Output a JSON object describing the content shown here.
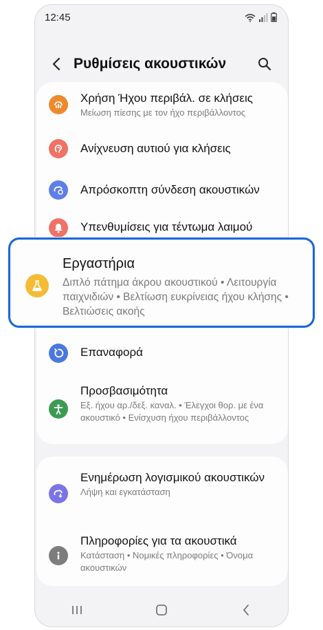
{
  "status_bar": {
    "time": "12:45"
  },
  "header": {
    "title": "Ρυθμίσεις ακουστικών"
  },
  "settings_group_1": [
    {
      "title": "Χρήση Ήχου περιβάλ. σε κλήσεις",
      "subtitle": "Μείωση πίεσης με τον ήχο περιβάλλοντος",
      "icon": "ambient-sound-icon",
      "color": "#ee8a2c"
    },
    {
      "title": "Ανίχνευση αυτιού για κλήσεις",
      "subtitle": "",
      "icon": "ear-detection-icon",
      "color": "#f07266"
    },
    {
      "title": "Απρόσκοπτη σύνδεση ακουστικών",
      "subtitle": "",
      "icon": "seamless-connection-icon",
      "color": "#5f7fe8"
    },
    {
      "title": "Υπενθυμίσεις για τέντωμα λαιμού",
      "subtitle": "",
      "icon": "bell-icon",
      "color": "#f07266"
    },
    {
      "title": "Επαναφορά",
      "subtitle": "",
      "icon": "reset-icon",
      "color": "#4a78e0"
    },
    {
      "title": "Προσβασιμότητα",
      "subtitle": "Εξ. ήχου αρ./δεξ. καναλ. • Έλεγχοι θορ. με ένα ακουστικό • Ενίσχυση ήχου περιβάλλοντος",
      "icon": "accessibility-icon",
      "color": "#3c9b52"
    }
  ],
  "highlighted_item": {
    "title": "Εργαστήρια",
    "subtitle": "Διπλό πάτημα άκρου ακουστικού • Λειτουργία παιχνιδιών • Βελτίωση ευκρίνειας ήχου κλήσης • Βελτιώσεις ακοής",
    "icon": "flask-icon",
    "color": "#f4bb35",
    "border_color": "#1a66d6"
  },
  "settings_group_2": [
    {
      "title": "Ενημέρωση λογισμικού ακουστικών",
      "subtitle": "Λήψη και εγκατάσταση",
      "icon": "software-update-icon",
      "color": "#7b74e6"
    },
    {
      "title": "Πληροφορίες για τα ακουστικά",
      "subtitle": "Κατάσταση • Νομικές πληροφορίες • Όνομα ακουστικών",
      "icon": "info-icon",
      "color": "#7d7d7d"
    }
  ]
}
